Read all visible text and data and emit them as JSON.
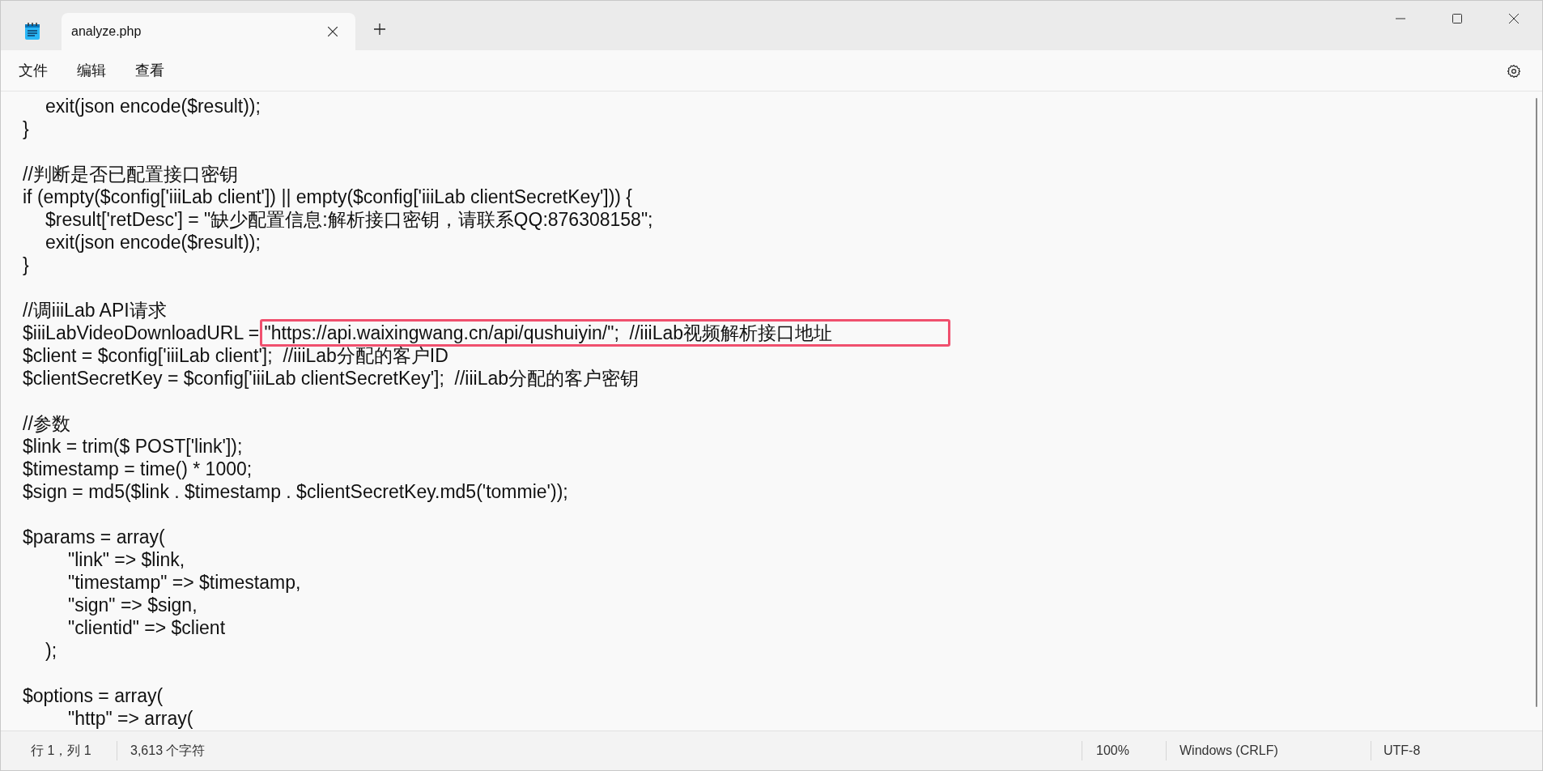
{
  "tabs": [
    {
      "label": "analyze.php",
      "selected": true
    }
  ],
  "menu": [
    "文件",
    "编辑",
    "查看"
  ],
  "blocks": [
    [
      {
        "text": "\texit(json encode($result));"
      },
      {
        "text": "}"
      }
    ],
    [
      {
        "text": "//判断是否已配置接口密钥"
      },
      {
        "text": "if (empty($config['iiiLab client']) || empty($config['iiiLab clientSecretKey'])) {"
      },
      {
        "text": "\t$result['retDesc'] = \"缺少配置信息:解析接口密钥，请联系QQ:876308158\";"
      },
      {
        "text": "\texit(json encode($result));"
      },
      {
        "text": "}"
      }
    ],
    [
      {
        "text": "//调iiiLab API请求"
      },
      {
        "text": "$iiiLabVideoDownloadURL = ",
        "highlighted": "\"https://api.waixingwang.cn/api/qushuiyin/\";  //iiiLab视频解析接口地址"
      },
      {
        "text": "$client = $config['iiiLab client'];  //iiiLab分配的客户ID"
      },
      {
        "text": "$clientSecretKey = $config['iiiLab clientSecretKey'];  //iiiLab分配的客户密钥"
      }
    ],
    [
      {
        "text": "//参数"
      },
      {
        "text": "$link = trim($ POST['link']);"
      },
      {
        "text": "$timestamp = time() * 1000;"
      },
      {
        "text": "$sign = md5($link . $timestamp . $clientSecretKey.md5('tommie'));"
      }
    ],
    [
      {
        "text": "$params = array("
      },
      {
        "text": "\t\t\"link\" => $link,"
      },
      {
        "text": "\t\t\"timestamp\" => $timestamp,"
      },
      {
        "text": "\t\t\"sign\" => $sign,"
      },
      {
        "text": "\t\t\"clientid\" => $client"
      },
      {
        "text": "\t);"
      }
    ],
    [
      {
        "text": "$options = array("
      },
      {
        "text": "\t\t\"http\" => array("
      }
    ]
  ],
  "status_bar": {
    "position": "行 1，列 1",
    "chars": "3,613 个字符",
    "zoom": "100%",
    "line_ending": "Windows (CRLF)",
    "encoding": "UTF-8"
  }
}
